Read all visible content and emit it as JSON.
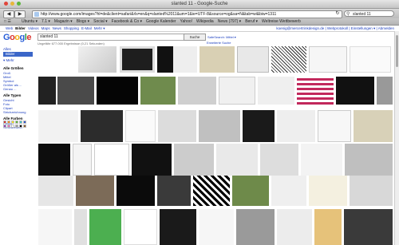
{
  "window": {
    "title": "slanted 11 - Google-Suche"
  },
  "toolbar": {
    "url": "http://www.google.com/images?hl=de&client=safari&rls=en&q=slanted%2011&um=1&ie=UTF-8&source=og&sa=N&tab=wi&biw=1311",
    "search_value": "slanted 11",
    "reload_glyph": "↻"
  },
  "bookmarks": {
    "control_label": "□ ☰",
    "items": [
      "Ubuntu ▾",
      "7.1 ▾",
      "Magazin ▾",
      "Blogs ▾",
      "Social ▾",
      "Facebook & Co ▾",
      "Google Kalender",
      "Yahoo!",
      "Wikipedia",
      "News (797) ▾",
      "Beruf ▾",
      "Weltreise Wettbewerb"
    ]
  },
  "gbar": {
    "links": [
      "Web",
      "Bilder",
      "Videos",
      "Maps",
      "News",
      "Shopping",
      "E-Mail",
      "Mehr ▾"
    ],
    "right": "koenig@mercertrinkdesign.de | Webprotokoll | Einstellungen ▾ | Abmelden"
  },
  "search": {
    "query": "slanted 11",
    "button_label": "Suche",
    "advanced_label": "Erweiterte Suche",
    "prefs_label": "SafeSearch: Mittel ▾",
    "stats": "Ungefähr 677.000 Ergebnisse (0,21 Sekunden)"
  },
  "sidebar": {
    "all": "Alles",
    "images": "Bilder",
    "more": "▾ Mehr",
    "size_head": "Alle Größen",
    "sizes": [
      "Groß",
      "Mittel",
      "Symbol",
      "Größer als ...",
      "Genau ..."
    ],
    "type_head": "Alle Typen",
    "types": [
      "Gesicht",
      "Foto",
      "Clipart",
      "Strichzeichnung"
    ],
    "color_head": "Alle Farben",
    "color_options": [
      "Farbig",
      "Schwarzweiß"
    ],
    "swatches": [
      "#d8322b",
      "#f08a1b",
      "#f4e11d",
      "#58b83b",
      "#39c0c8",
      "#2b50c8",
      "#8b3bc0",
      "#e56bb8",
      "#ffffff",
      "#9a9a9a",
      "#000000",
      "#8b5a2b"
    ]
  }
}
